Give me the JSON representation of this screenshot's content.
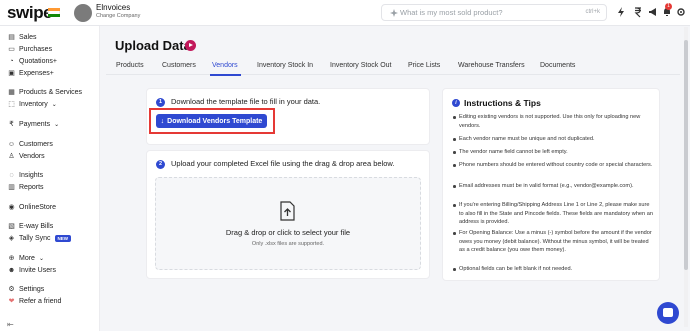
{
  "header": {
    "logo": "swipe",
    "company_name": "Elnvoices",
    "company_action": "Change Company",
    "search_placeholder": "What is my most sold product?",
    "search_shortcut": "ctrl+k",
    "notification_count": "1"
  },
  "sidebar": {
    "items": [
      {
        "icon": "▤",
        "label": "Sales",
        "suffix": ""
      },
      {
        "icon": "▭",
        "label": "Purchases",
        "suffix": ""
      },
      {
        "icon": "◔",
        "label": "Quotations+",
        "suffix": ""
      },
      {
        "icon": "▣",
        "label": "Expenses+",
        "suffix": ""
      },
      {
        "icon": "▦",
        "label": "Products & Services",
        "suffix": ""
      },
      {
        "icon": "⬚",
        "label": "Inventory",
        "suffix": "⌄"
      },
      {
        "icon": "₹",
        "label": "Payments",
        "suffix": "⌄"
      },
      {
        "icon": "☺",
        "label": "Customers",
        "suffix": ""
      },
      {
        "icon": "♙",
        "label": "Vendors",
        "suffix": ""
      },
      {
        "icon": "◌",
        "label": "Insights",
        "suffix": ""
      },
      {
        "icon": "▥",
        "label": "Reports",
        "suffix": ""
      },
      {
        "icon": "◉",
        "label": "OnlineStore",
        "suffix": ""
      },
      {
        "icon": "▧",
        "label": "E-way Bills",
        "suffix": ""
      },
      {
        "icon": "◈",
        "label": "Tally Sync",
        "suffix": ""
      },
      {
        "icon": "⊕",
        "label": "More",
        "suffix": "⌄"
      },
      {
        "icon": "☻",
        "label": "Invite Users",
        "suffix": ""
      },
      {
        "icon": "⚙",
        "label": "Settings",
        "suffix": ""
      },
      {
        "icon": "❤",
        "label": "Refer a friend",
        "suffix": ""
      }
    ],
    "tally_badge": "NEW",
    "collapse_icon": "⇤"
  },
  "page": {
    "title": "Upload Data",
    "tabs": [
      "Products",
      "Customers",
      "Vendors",
      "Inventory Stock In",
      "Inventory Stock Out",
      "Price Lists",
      "Warehouse Transfers",
      "Documents"
    ],
    "active_tab": "Vendors"
  },
  "step1": {
    "number": "1",
    "text": "Download the template file to fill in your data.",
    "button_label": "Download Vendors Template",
    "button_icon": "↓"
  },
  "step2": {
    "number": "2",
    "text": "Upload your completed Excel file using the drag & drop area below.",
    "drop_text": "Drag & drop or click to select your file",
    "drop_subtext": "Only .xlsx files are supported."
  },
  "tips": {
    "title": "Instructions & Tips",
    "items": [
      "Editing existing vendors is not supported. Use this only for uploading new vendors.",
      "Each vendor name must be unique and not duplicated.",
      "The vendor name field cannot be left empty.",
      "Phone numbers should be entered without country code or special characters.",
      "Email addresses must be in valid format (e.g., vendor@example.com).",
      "If you're entering Billing/Shipping Address Line 1 or Line 2, please make sure to also fill in the State and Pincode fields. These fields are mandatory when an address is provided.",
      "For Opening Balance: Use a minus (-) symbol before the amount if the vendor owes you money (debit balance). Without the minus symbol, it will be treated as a credit balance (you owe them money).",
      "Optional fields can be left blank if not needed."
    ]
  },
  "colors": {
    "accent": "#2f49d1",
    "highlight_box": "#e53935",
    "play_button": "#c2185b"
  }
}
